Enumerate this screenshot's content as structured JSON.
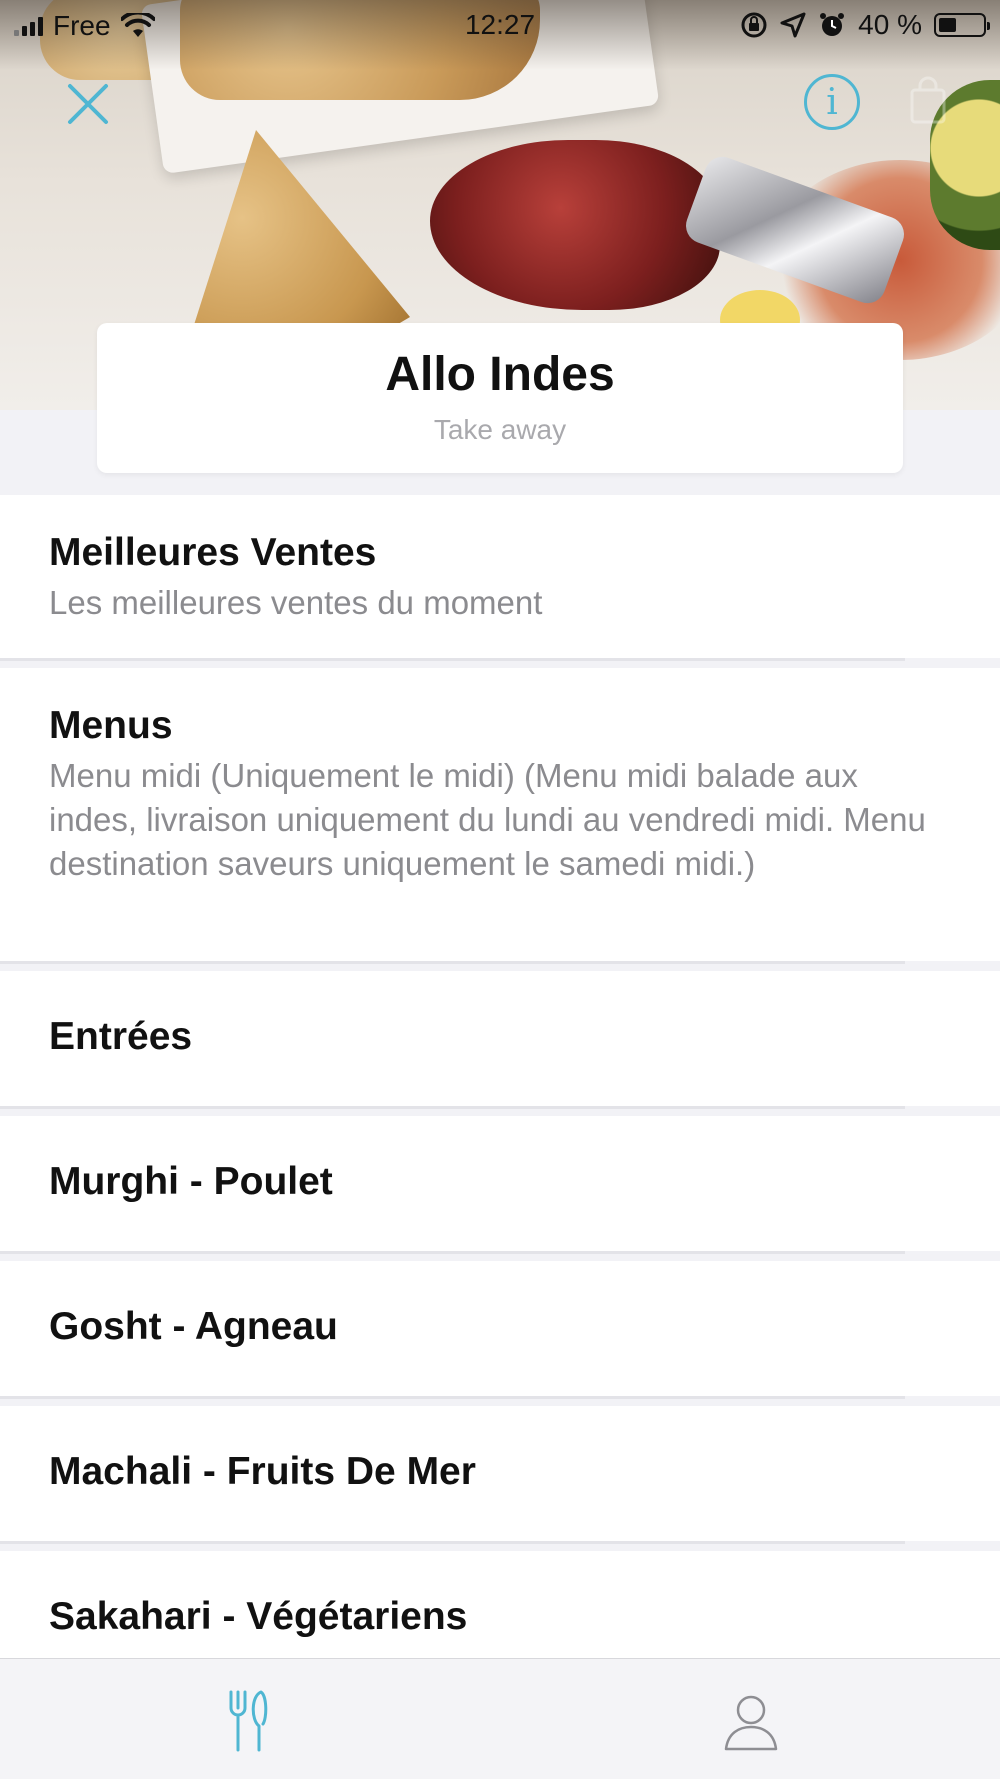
{
  "status_bar": {
    "carrier": "Free",
    "time": "12:27",
    "battery_percent": "40 %",
    "battery_level": 0.4
  },
  "header": {
    "restaurant_name": "Allo Indes",
    "subtitle": "Take away"
  },
  "categories": [
    {
      "title": "Meilleures Ventes",
      "description": "Les meilleures ventes du moment"
    },
    {
      "title": "Menus",
      "description": "Menu midi (Uniquement le midi) (Menu midi balade aux indes, livraison uniquement du lundi au vendredi midi. Menu destination saveurs uniquement le samedi midi.)"
    },
    {
      "title": "Entrées",
      "description": ""
    },
    {
      "title": "Murghi - Poulet",
      "description": ""
    },
    {
      "title": "Gosht - Agneau",
      "description": ""
    },
    {
      "title": "Machali - Fruits De Mer",
      "description": ""
    },
    {
      "title": "Sakahari - Végétariens",
      "description": ""
    }
  ],
  "tabs": [
    {
      "icon": "fork-knife-icon",
      "active": true
    },
    {
      "icon": "profile-icon",
      "active": false
    }
  ],
  "colors": {
    "accent": "#4fb6d2",
    "background": "#f2f2f6",
    "inactive_tab": "#8e8e93"
  }
}
